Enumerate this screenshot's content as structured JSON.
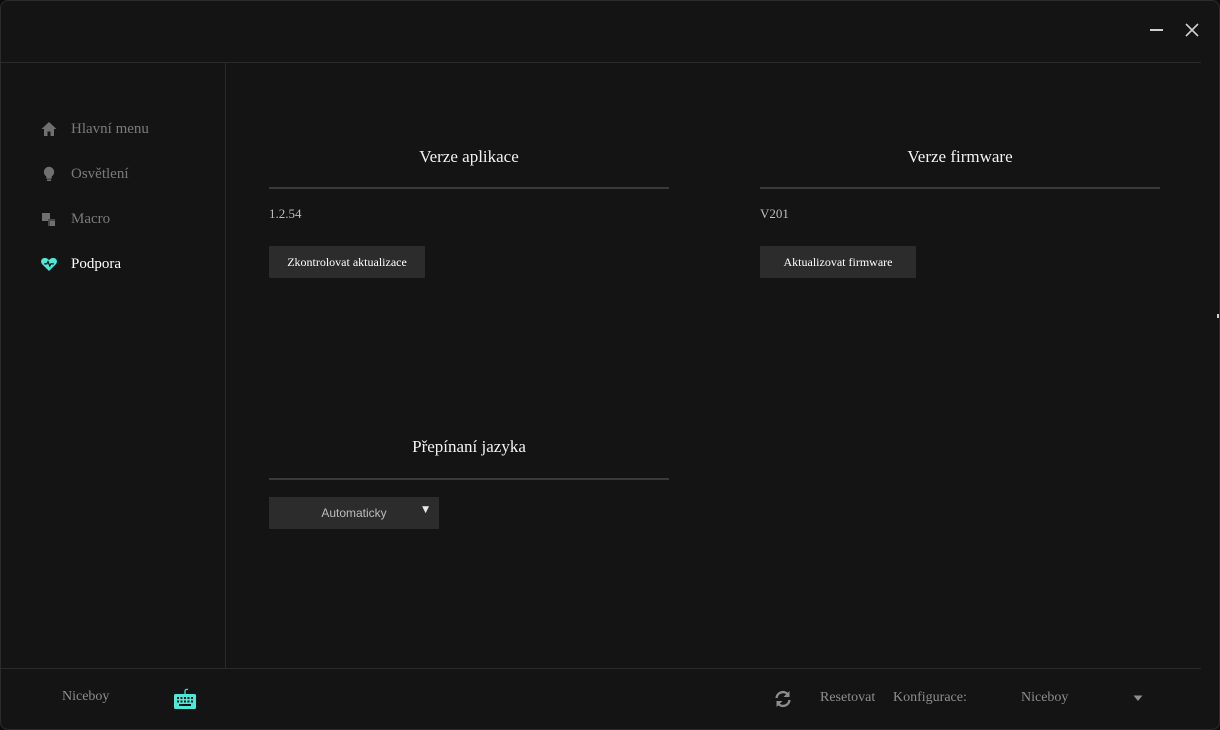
{
  "titlebar": {
    "title_fragment": "",
    "minimize_icon": "minimize-icon",
    "close_icon": "close-icon"
  },
  "sidebar": {
    "items": [
      {
        "label": "Hlavní menu",
        "icon": "home-icon",
        "active": false
      },
      {
        "label": "Osvětlení",
        "icon": "lightbulb-icon",
        "active": false
      },
      {
        "label": "Macro",
        "icon": "macro-icon",
        "active": false
      },
      {
        "label": "Podpora",
        "icon": "heart-icon",
        "active": true
      }
    ]
  },
  "main": {
    "app_version": {
      "title": "Verze aplikace",
      "value": "1.2.54",
      "button_label": "Zkontrolovat aktualizace"
    },
    "firmware_version": {
      "title": "Verze firmware",
      "value": "V201",
      "button_label": "Aktualizovat firmware"
    },
    "language": {
      "title": "Přepínaní jazyka",
      "selected": "Automaticky"
    }
  },
  "footer": {
    "device_name": "Niceboy",
    "keyboard_icon": "keyboard-icon",
    "refresh_icon": "refresh-icon",
    "reset_label": "Resetovat",
    "config_label": "Konfigurace:",
    "config_value": "Niceboy",
    "dropdown_icon": "chevron-down-icon"
  },
  "colors": {
    "background": "#141414",
    "accent": "#4ee8d8",
    "button": "#2c2c2c"
  }
}
